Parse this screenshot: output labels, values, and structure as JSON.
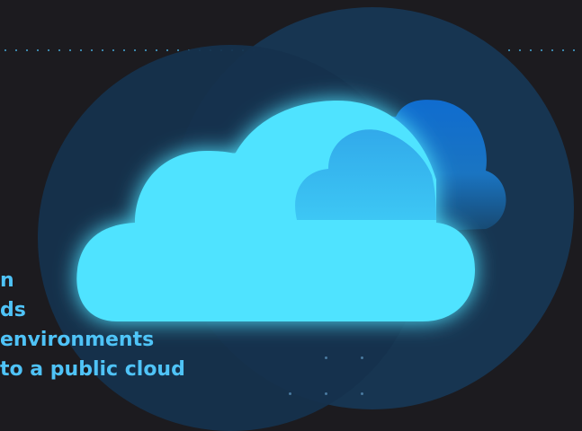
{
  "headline": {
    "line1": "n",
    "line2": "ds",
    "line3": "environments",
    "line4": "to a public cloud"
  },
  "icons": {
    "main": "cloud-icon",
    "secondary": "cloud-icon"
  },
  "colors": {
    "background": "#1c1b1f",
    "cloud_primary": "#4fe3ff",
    "cloud_secondary": "#1e7fd0",
    "headline_text": "#4fc3f7",
    "circle_dark": "#15314d",
    "circle_mid": "#163a5a"
  }
}
